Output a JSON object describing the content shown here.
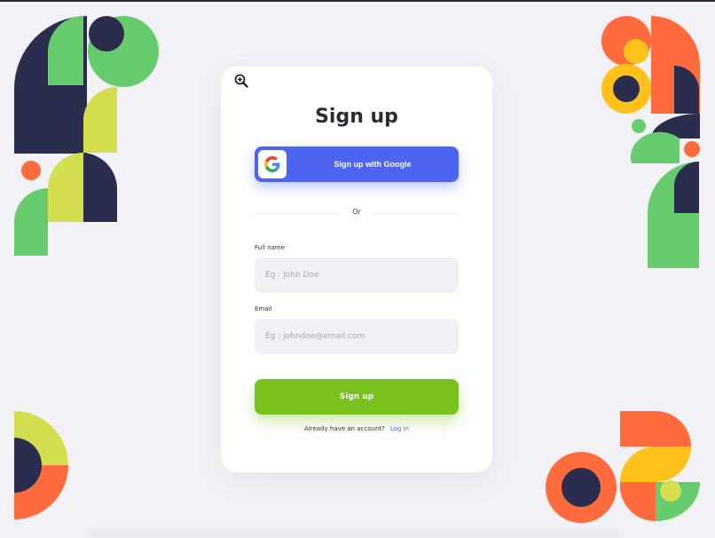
{
  "zoom": {
    "icon": "zoom-in-icon"
  },
  "form": {
    "title": "Sign up",
    "google_button": "Sign up with Google",
    "divider_text": "Or",
    "full_name": {
      "label": "Full name",
      "placeholder": "Eg : John Doe"
    },
    "email": {
      "label": "Email",
      "placeholder": "Eg : johndoe@email.com"
    },
    "submit_label": "Sign up",
    "footer_text": "Already have an account?",
    "login_link": "Log in"
  },
  "colors": {
    "background": "#f2f2f6",
    "card": "#ffffff",
    "google_button": "#4d64f0",
    "submit_button": "#79c11d",
    "input_bg": "#f1f1f5",
    "navy": "#2b2d4f",
    "green": "#66cc6e",
    "lime": "#d4df4f",
    "orange": "#ff6b3d",
    "yellow": "#ffc21a"
  }
}
